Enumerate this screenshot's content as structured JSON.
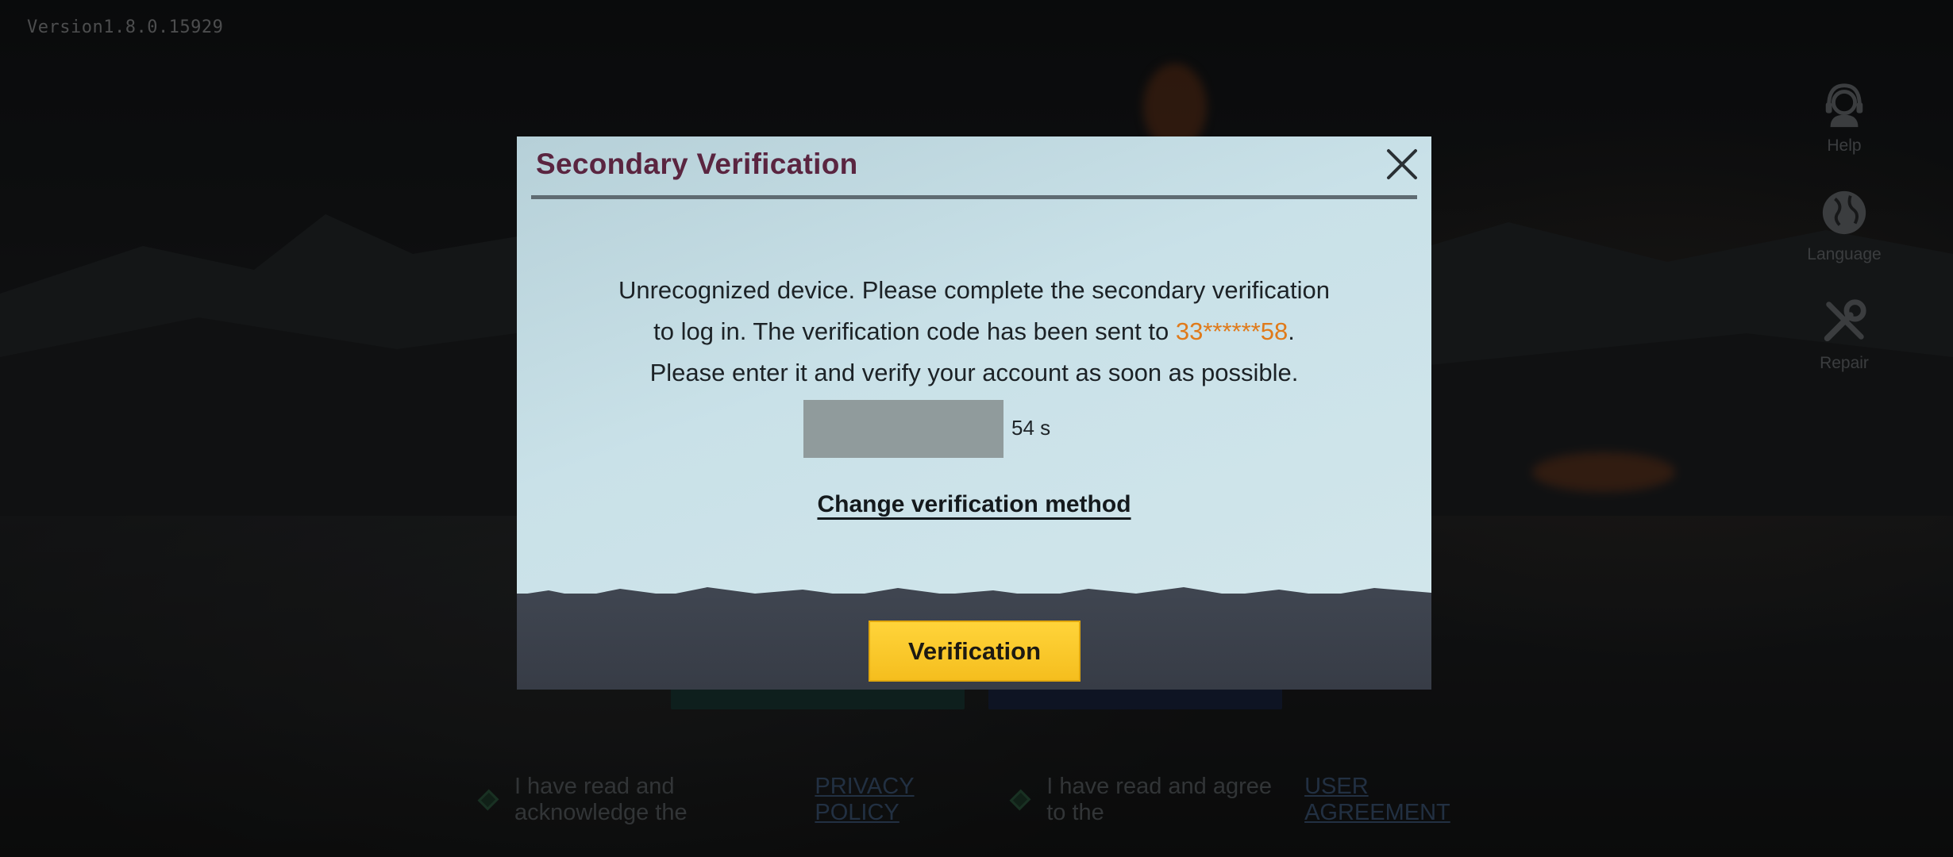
{
  "version": "Version1.8.0.15929",
  "side_tools": [
    {
      "label": "Help",
      "icon": "headset-icon"
    },
    {
      "label": "Language",
      "icon": "globe-icon"
    },
    {
      "label": "Repair",
      "icon": "wrench-icon"
    }
  ],
  "agreements": {
    "privacy_text": "I have read and acknowledge the",
    "privacy_link": "PRIVACY POLICY",
    "user_text": "I have read and agree to the",
    "user_link": "USER AGREEMENT"
  },
  "dialog": {
    "title": "Secondary Verification",
    "message_line1": "Unrecognized device. Please complete the secondary verification",
    "message_line2_prefix": "to log in. The verification code has been sent to",
    "phone_masked": "33******58",
    "message_line2_suffix": ".",
    "message_line3": "Please enter it and verify your account as soon as possible.",
    "code_input_value": "",
    "countdown": "54 s",
    "change_method_label": "Change verification method",
    "verify_button_label": "Verification"
  },
  "colors": {
    "title": "#5a2540",
    "phone_highlight": "#e07a1a",
    "verify_button": "#f5be1e",
    "dialog_bg": "#c9e1e8"
  }
}
